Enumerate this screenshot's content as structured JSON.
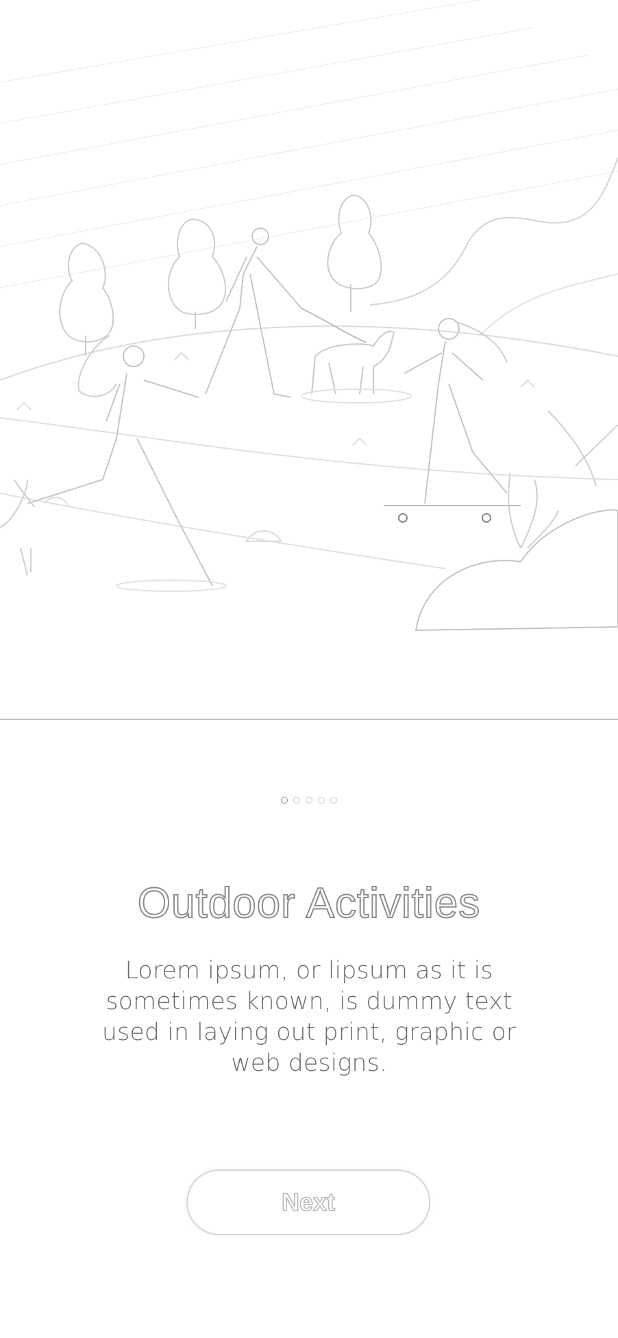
{
  "illustration": {
    "icon": "outdoor-activities-illustration"
  },
  "pager": {
    "total": 5,
    "active_index": 0
  },
  "onboarding": {
    "title": "Outdoor Activities",
    "description": "Lorem ipsum, or lipsum as it is sometimes known, is dummy text used in laying out print, graphic or web designs.",
    "next_label": "Next"
  },
  "colors": {
    "outline": "#8d8d8d",
    "line_light": "#d9d9d9",
    "text": "#6b6b6b"
  }
}
